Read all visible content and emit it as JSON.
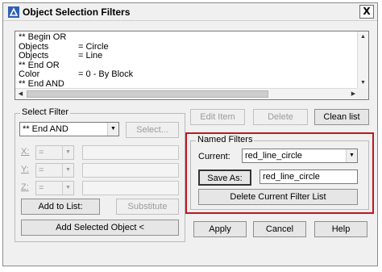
{
  "window": {
    "title": "Object Selection Filters",
    "close_label": "X"
  },
  "filter_list": {
    "rows": [
      {
        "k": "** Begin OR",
        "v": ""
      },
      {
        "k": "Objects",
        "v": "= Circle"
      },
      {
        "k": "Objects",
        "v": "= Line"
      },
      {
        "k": "** End OR",
        "v": ""
      },
      {
        "k": "Color",
        "v": "= 0 - By Block"
      },
      {
        "k": "** End AND",
        "v": ""
      }
    ]
  },
  "list_buttons": {
    "edit_item": "Edit Item",
    "delete": "Delete",
    "clean_list": "Clean list"
  },
  "select_filter": {
    "group_label": "Select Filter",
    "type_value": "** End AND",
    "select_button": "Select...",
    "x_label": "X:",
    "y_label": "Y:",
    "z_label": "Z:",
    "x_op": "=",
    "y_op": "=",
    "z_op": "=",
    "add_to_list": "Add to List:",
    "substitute": "Substitute",
    "add_selected_object": "Add Selected Object <"
  },
  "named_filters": {
    "group_label": "Named Filters",
    "current_label": "Current:",
    "current_value": "red_line_circle",
    "save_as_button": "Save As:",
    "save_as_value": "red_line_circle",
    "delete_button": "Delete Current Filter List"
  },
  "footer": {
    "apply": "Apply",
    "cancel": "Cancel",
    "help": "Help"
  },
  "colors": {
    "highlight": "#c0171d",
    "dialog_bg": "#f0f0f0"
  }
}
